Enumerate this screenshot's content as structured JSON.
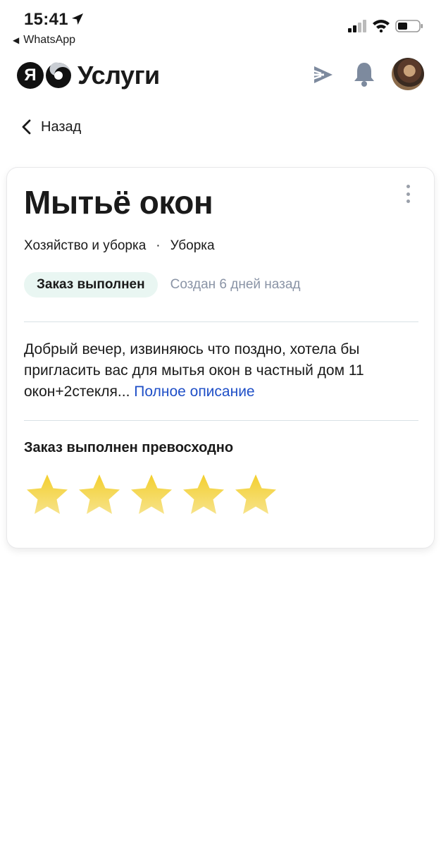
{
  "status_bar": {
    "time": "15:41",
    "back_app": "WhatsApp"
  },
  "header": {
    "logo_letter": "Я",
    "logo_text": "Услуги",
    "icons": [
      "send-icon",
      "bell-icon",
      "avatar"
    ]
  },
  "nav": {
    "back_label": "Назад"
  },
  "order": {
    "title": "Мытьё окон",
    "category": "Хозяйство и уборка",
    "separator": "·",
    "subcategory": "Уборка",
    "status_badge": "Заказ выполнен",
    "created": "Создан 6 дней назад",
    "description": "Добрый вечер, извиняюсь что поздно, хотела бы пригласить вас для мытья окон в частный дом 11 окон+2стекля...",
    "full_description_link": "Полное описание",
    "rating_title": "Заказ выполнен превосходно",
    "rating": 5,
    "rating_max": 5
  },
  "colors": {
    "badge_bg": "#e9f6f2",
    "link": "#1f4fc7",
    "muted": "#8a94a6",
    "star": "#f5d23c",
    "icon": "#7d8a9e"
  }
}
